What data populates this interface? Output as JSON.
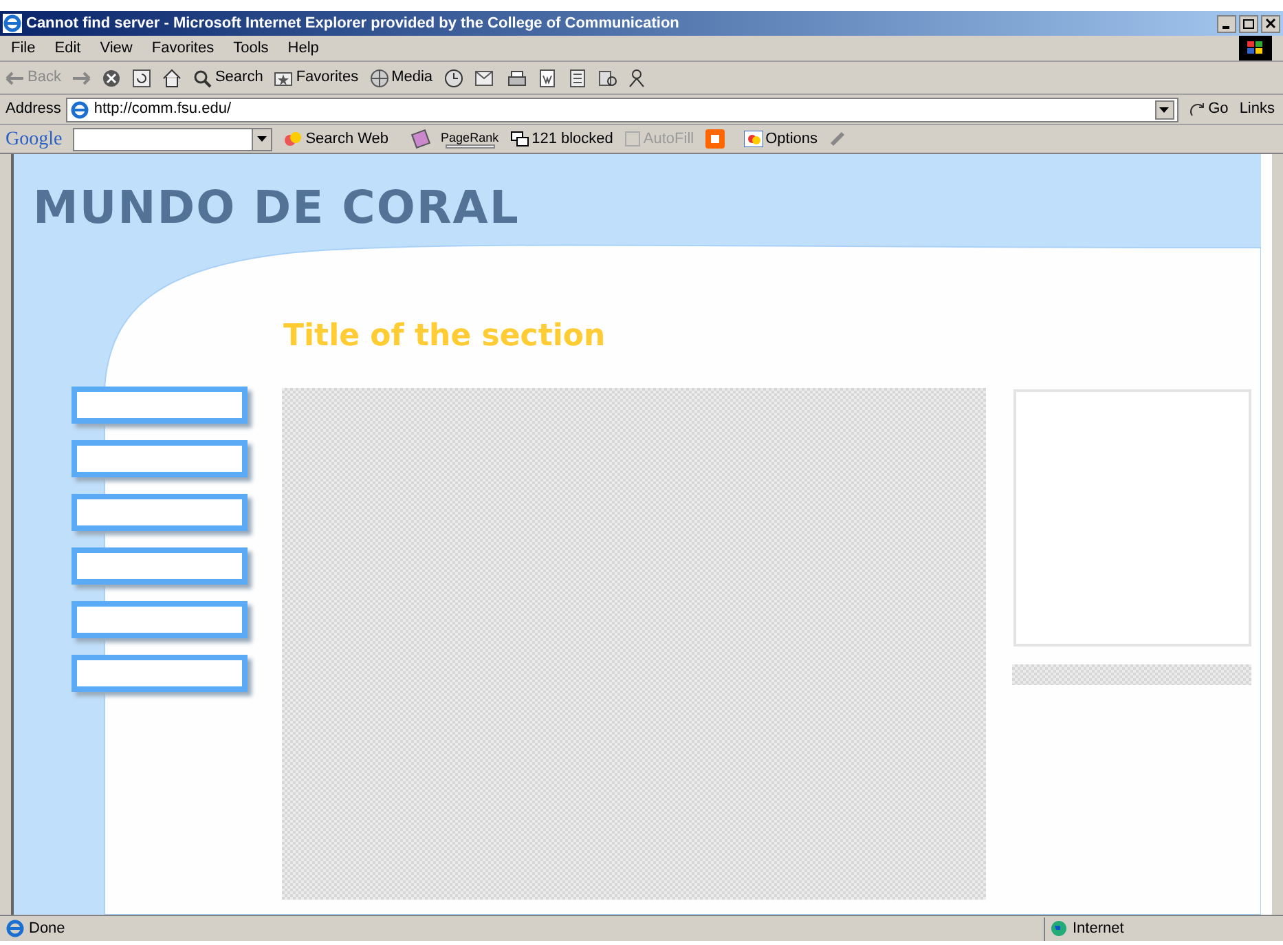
{
  "window": {
    "title": "Cannot find server - Microsoft Internet Explorer provided by the College of Communication"
  },
  "menu": [
    "File",
    "Edit",
    "View",
    "Favorites",
    "Tools",
    "Help"
  ],
  "toolbar": [
    {
      "kind": "back",
      "label": "Back",
      "disabled": true
    },
    {
      "kind": "forward",
      "disabled": true
    },
    {
      "kind": "stop"
    },
    {
      "kind": "refresh"
    },
    {
      "kind": "home"
    },
    {
      "kind": "search",
      "label": "Search"
    },
    {
      "kind": "favorites",
      "label": "Favorites"
    },
    {
      "kind": "media",
      "label": "Media"
    },
    {
      "kind": "history"
    },
    {
      "kind": "mail"
    },
    {
      "kind": "print"
    },
    {
      "kind": "edit"
    },
    {
      "kind": "discuss"
    },
    {
      "kind": "research"
    },
    {
      "kind": "messenger"
    }
  ],
  "address": {
    "label": "Address",
    "value": "http://comm.fsu.edu/",
    "go": "Go",
    "links": "Links"
  },
  "google_bar": {
    "logo": "Google",
    "search_button": "Search Web",
    "pagerank": "PageRank",
    "blocked": "121 blocked",
    "autofill": "AutoFill",
    "options": "Options"
  },
  "page": {
    "site_title": "MUNDO DE CORAL",
    "section_title": "Title of the section",
    "nav_buttons": [
      {
        "kind": "blank"
      },
      {
        "kind": "blank"
      },
      {
        "kind": "blank"
      },
      {
        "kind": "blank"
      },
      {
        "kind": "blank"
      },
      {
        "kind": "blank"
      }
    ]
  },
  "status_bar": {
    "text": "Done",
    "zone": "Internet"
  }
}
